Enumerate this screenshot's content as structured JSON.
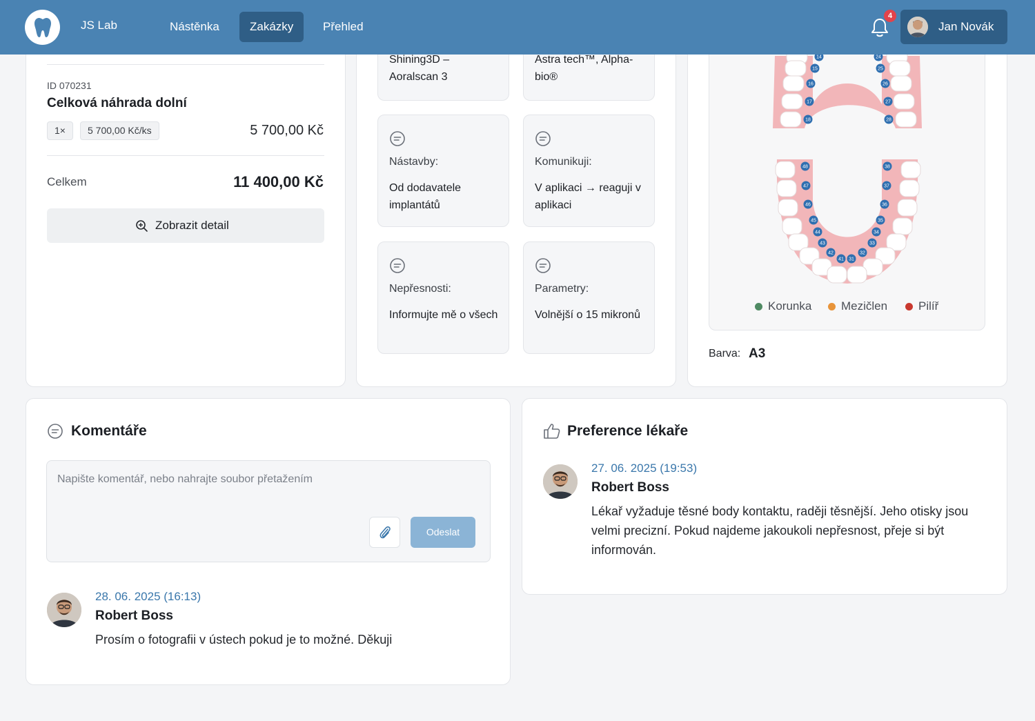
{
  "header": {
    "brand": "JS Lab",
    "nav": [
      {
        "label": "Nástěnka",
        "active": false
      },
      {
        "label": "Zakázky",
        "active": true
      },
      {
        "label": "Přehled",
        "active": false
      }
    ],
    "notification_count": "4",
    "user_name": "Jan Novák",
    "accent_color": "#4a83b3",
    "active_nav_color": "#2f5e86"
  },
  "order": {
    "item_id": "ID 070231",
    "item_name": "Celková náhrada dolní",
    "quantity": "1×",
    "unit_price": "5 700,00 Kč/ks",
    "item_total": "5 700,00 Kč",
    "total_label": "Celkem",
    "total_value": "11 400,00 Kč",
    "detail_button": "Zobrazit detail"
  },
  "prefs": {
    "top_left": "Shining3D – Aoralscan 3",
    "top_right": "Astra tech™, Alpha-bio®",
    "cards": [
      {
        "label": "Nástavby:",
        "value": "Od dodavatele implantátů"
      },
      {
        "label": "Komunikuji:",
        "value": "V aplikaci → reaguji v aplikaci"
      },
      {
        "label": "Nepřesnosti:",
        "value": "Informujte mě o všech"
      },
      {
        "label": "Parametry:",
        "value": "Volnější o 15 mikronů"
      }
    ]
  },
  "teeth": {
    "upper_right": [
      "14",
      "15",
      "16",
      "17",
      "18"
    ],
    "upper_left": [
      "24",
      "25",
      "26",
      "27",
      "28"
    ],
    "lower_right": [
      "48",
      "47",
      "46",
      "45",
      "44",
      "43",
      "42",
      "41"
    ],
    "lower_left": [
      "38",
      "37",
      "36",
      "35",
      "34",
      "33",
      "32",
      "31"
    ],
    "legend": [
      {
        "label": "Korunka",
        "color": "#4f8a63"
      },
      {
        "label": "Mezičlen",
        "color": "#e8943a"
      },
      {
        "label": "Pilíř",
        "color": "#c9392f"
      }
    ],
    "shade_label": "Barva:",
    "shade_value": "A3"
  },
  "comments": {
    "title": "Komentáře",
    "placeholder": "Napište komentář, nebo nahrajte soubor přetažením",
    "send_label": "Odeslat",
    "items": [
      {
        "date": "28. 06. 2025 (16:13)",
        "author": "Robert Boss",
        "text": "Prosím o fotografii v ústech pokud je to možné. Děkuji"
      }
    ]
  },
  "doctor_prefs": {
    "title": "Preference lékaře",
    "items": [
      {
        "date": "27. 06. 2025 (19:53)",
        "author": "Robert Boss",
        "text": "Lékař vyžaduje těsné body kontaktu, raději těsnější. Jeho otisky jsou velmi precizní. Pokud najdeme jakoukoli nepřesnost, přeje si být informován."
      }
    ]
  }
}
